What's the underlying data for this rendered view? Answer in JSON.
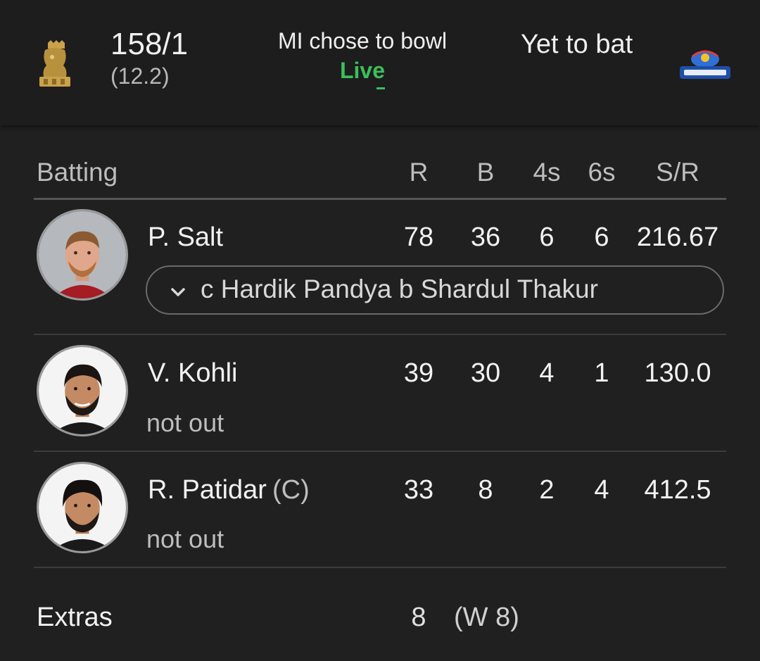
{
  "header": {
    "team1_logo": "rcb-logo-icon",
    "score": "158/1",
    "overs": "(12.2)",
    "toss": "MI chose to bowl",
    "live": "Live",
    "team2_status": "Yet to bat",
    "team2_logo": "mumbai-indians-logo-icon",
    "colors": {
      "live": "#3bbf5b",
      "background": "#202020"
    }
  },
  "table": {
    "headers": {
      "batting": "Batting",
      "r": "R",
      "b": "B",
      "fours": "4s",
      "sixes": "6s",
      "sr": "S/R"
    },
    "batters": [
      {
        "name": "P. Salt",
        "captain": "",
        "r": "78",
        "b": "36",
        "fours": "6",
        "sixes": "6",
        "sr": "216.67",
        "dismissal": "c Hardik Pandya b Shardul Thakur",
        "status": ""
      },
      {
        "name": "V. Kohli",
        "captain": "",
        "r": "39",
        "b": "30",
        "fours": "4",
        "sixes": "1",
        "sr": "130.0",
        "dismissal": "",
        "status": "not out"
      },
      {
        "name": "R. Patidar",
        "captain": "(C)",
        "r": "33",
        "b": "8",
        "fours": "2",
        "sixes": "4",
        "sr": "412.5",
        "dismissal": "",
        "status": "not out"
      }
    ]
  },
  "extras": {
    "label": "Extras",
    "value": "8",
    "detail": "(W 8)"
  }
}
